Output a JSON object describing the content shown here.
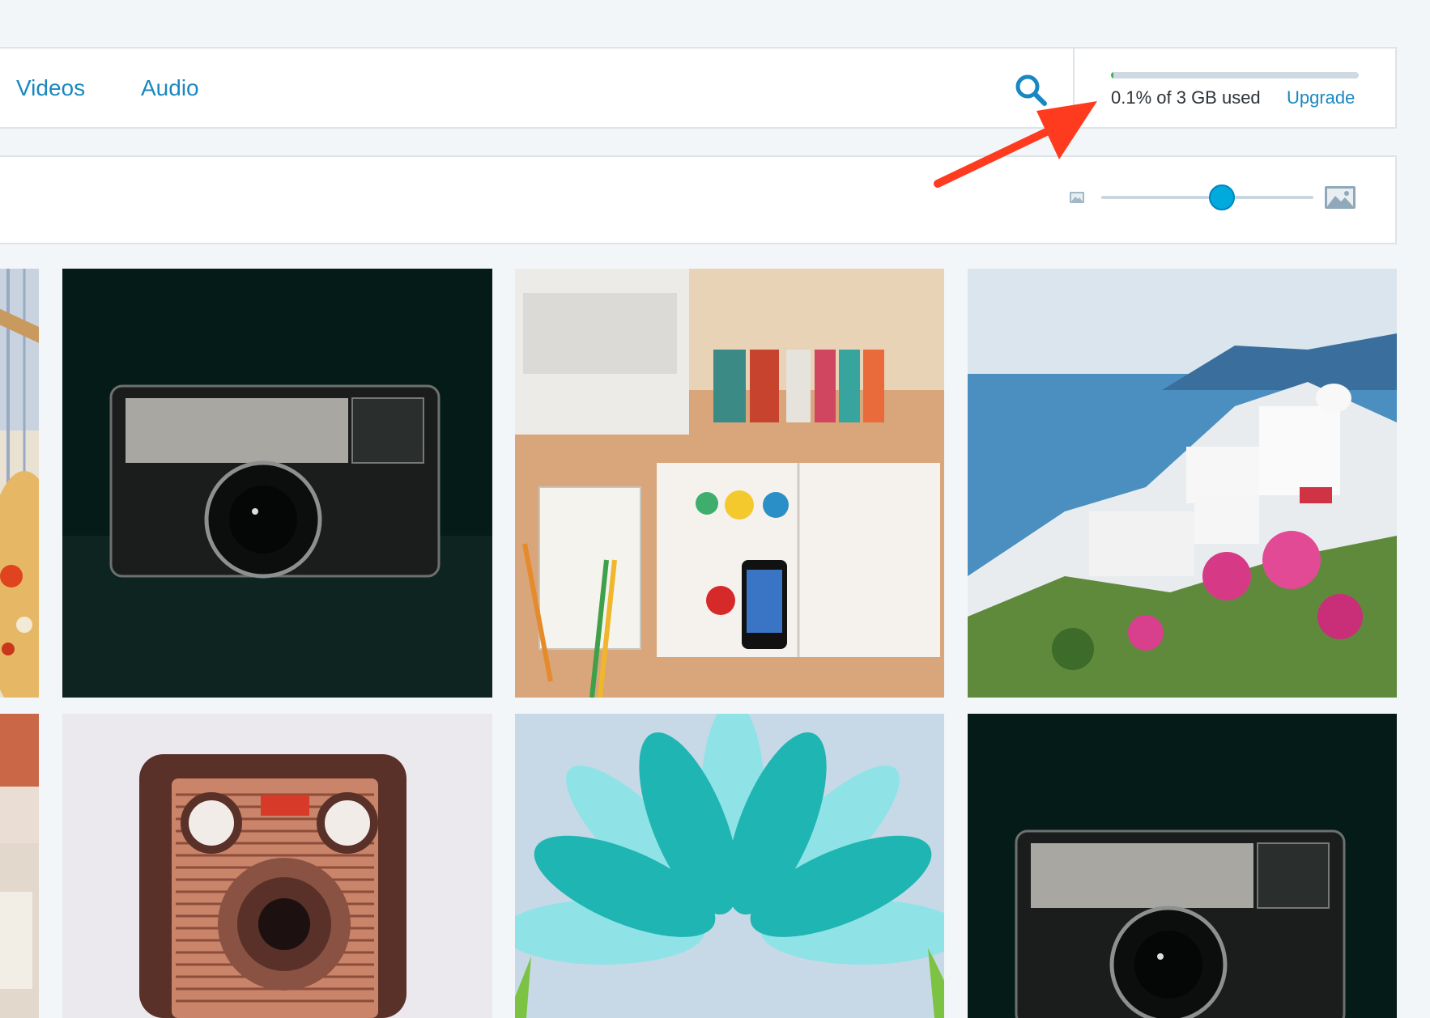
{
  "tabs": [
    {
      "label": "Videos"
    },
    {
      "label": "Audio"
    }
  ],
  "search": {
    "icon": "search-icon"
  },
  "storage": {
    "used_text": "0.1% of 3 GB used",
    "used_fraction": 0.001,
    "upgrade_label": "Upgrade"
  },
  "zoom": {
    "small_icon": "image-small-icon",
    "large_icon": "image-large-icon",
    "level_fraction": 0.57
  },
  "media": [
    {
      "name": "food-partial"
    },
    {
      "name": "kodak-instamatic"
    },
    {
      "name": "desk-workspace"
    },
    {
      "name": "santorini"
    },
    {
      "name": "food-partial-2"
    },
    {
      "name": "kodak-box-camera"
    },
    {
      "name": "teal-flower"
    },
    {
      "name": "kodak-instamatic-2"
    }
  ],
  "colors": {
    "accent": "#1a88c0",
    "slider": "#00aadc",
    "storage_fill": "#3bb54a",
    "annotation": "#ff3b1f"
  }
}
